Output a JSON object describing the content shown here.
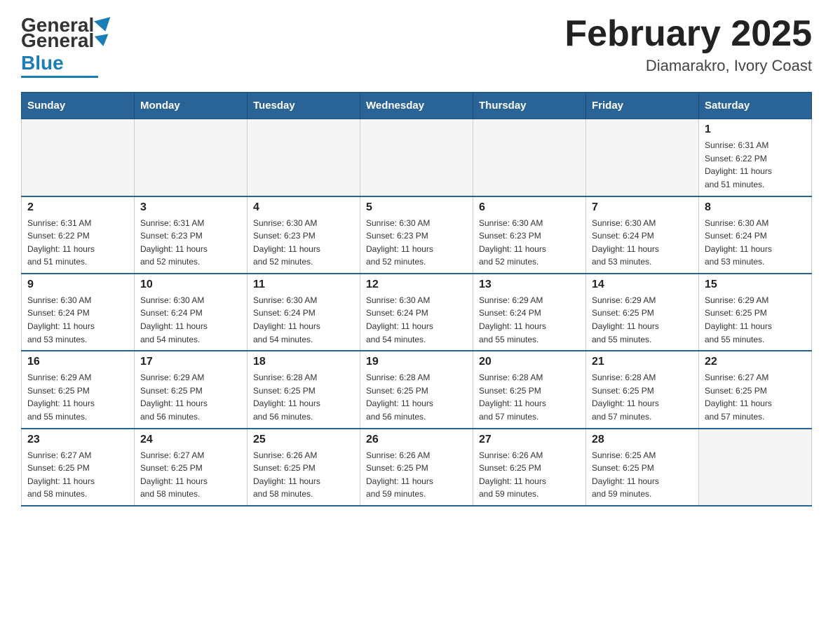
{
  "header": {
    "logo_general": "General",
    "logo_blue": "Blue",
    "month_title": "February 2025",
    "location": "Diamarakro, Ivory Coast"
  },
  "days_of_week": [
    "Sunday",
    "Monday",
    "Tuesday",
    "Wednesday",
    "Thursday",
    "Friday",
    "Saturday"
  ],
  "weeks": [
    [
      {
        "day": "",
        "info": ""
      },
      {
        "day": "",
        "info": ""
      },
      {
        "day": "",
        "info": ""
      },
      {
        "day": "",
        "info": ""
      },
      {
        "day": "",
        "info": ""
      },
      {
        "day": "",
        "info": ""
      },
      {
        "day": "1",
        "info": "Sunrise: 6:31 AM\nSunset: 6:22 PM\nDaylight: 11 hours\nand 51 minutes."
      }
    ],
    [
      {
        "day": "2",
        "info": "Sunrise: 6:31 AM\nSunset: 6:22 PM\nDaylight: 11 hours\nand 51 minutes."
      },
      {
        "day": "3",
        "info": "Sunrise: 6:31 AM\nSunset: 6:23 PM\nDaylight: 11 hours\nand 52 minutes."
      },
      {
        "day": "4",
        "info": "Sunrise: 6:30 AM\nSunset: 6:23 PM\nDaylight: 11 hours\nand 52 minutes."
      },
      {
        "day": "5",
        "info": "Sunrise: 6:30 AM\nSunset: 6:23 PM\nDaylight: 11 hours\nand 52 minutes."
      },
      {
        "day": "6",
        "info": "Sunrise: 6:30 AM\nSunset: 6:23 PM\nDaylight: 11 hours\nand 52 minutes."
      },
      {
        "day": "7",
        "info": "Sunrise: 6:30 AM\nSunset: 6:24 PM\nDaylight: 11 hours\nand 53 minutes."
      },
      {
        "day": "8",
        "info": "Sunrise: 6:30 AM\nSunset: 6:24 PM\nDaylight: 11 hours\nand 53 minutes."
      }
    ],
    [
      {
        "day": "9",
        "info": "Sunrise: 6:30 AM\nSunset: 6:24 PM\nDaylight: 11 hours\nand 53 minutes."
      },
      {
        "day": "10",
        "info": "Sunrise: 6:30 AM\nSunset: 6:24 PM\nDaylight: 11 hours\nand 54 minutes."
      },
      {
        "day": "11",
        "info": "Sunrise: 6:30 AM\nSunset: 6:24 PM\nDaylight: 11 hours\nand 54 minutes."
      },
      {
        "day": "12",
        "info": "Sunrise: 6:30 AM\nSunset: 6:24 PM\nDaylight: 11 hours\nand 54 minutes."
      },
      {
        "day": "13",
        "info": "Sunrise: 6:29 AM\nSunset: 6:24 PM\nDaylight: 11 hours\nand 55 minutes."
      },
      {
        "day": "14",
        "info": "Sunrise: 6:29 AM\nSunset: 6:25 PM\nDaylight: 11 hours\nand 55 minutes."
      },
      {
        "day": "15",
        "info": "Sunrise: 6:29 AM\nSunset: 6:25 PM\nDaylight: 11 hours\nand 55 minutes."
      }
    ],
    [
      {
        "day": "16",
        "info": "Sunrise: 6:29 AM\nSunset: 6:25 PM\nDaylight: 11 hours\nand 55 minutes."
      },
      {
        "day": "17",
        "info": "Sunrise: 6:29 AM\nSunset: 6:25 PM\nDaylight: 11 hours\nand 56 minutes."
      },
      {
        "day": "18",
        "info": "Sunrise: 6:28 AM\nSunset: 6:25 PM\nDaylight: 11 hours\nand 56 minutes."
      },
      {
        "day": "19",
        "info": "Sunrise: 6:28 AM\nSunset: 6:25 PM\nDaylight: 11 hours\nand 56 minutes."
      },
      {
        "day": "20",
        "info": "Sunrise: 6:28 AM\nSunset: 6:25 PM\nDaylight: 11 hours\nand 57 minutes."
      },
      {
        "day": "21",
        "info": "Sunrise: 6:28 AM\nSunset: 6:25 PM\nDaylight: 11 hours\nand 57 minutes."
      },
      {
        "day": "22",
        "info": "Sunrise: 6:27 AM\nSunset: 6:25 PM\nDaylight: 11 hours\nand 57 minutes."
      }
    ],
    [
      {
        "day": "23",
        "info": "Sunrise: 6:27 AM\nSunset: 6:25 PM\nDaylight: 11 hours\nand 58 minutes."
      },
      {
        "day": "24",
        "info": "Sunrise: 6:27 AM\nSunset: 6:25 PM\nDaylight: 11 hours\nand 58 minutes."
      },
      {
        "day": "25",
        "info": "Sunrise: 6:26 AM\nSunset: 6:25 PM\nDaylight: 11 hours\nand 58 minutes."
      },
      {
        "day": "26",
        "info": "Sunrise: 6:26 AM\nSunset: 6:25 PM\nDaylight: 11 hours\nand 59 minutes."
      },
      {
        "day": "27",
        "info": "Sunrise: 6:26 AM\nSunset: 6:25 PM\nDaylight: 11 hours\nand 59 minutes."
      },
      {
        "day": "28",
        "info": "Sunrise: 6:25 AM\nSunset: 6:25 PM\nDaylight: 11 hours\nand 59 minutes."
      },
      {
        "day": "",
        "info": ""
      }
    ]
  ]
}
